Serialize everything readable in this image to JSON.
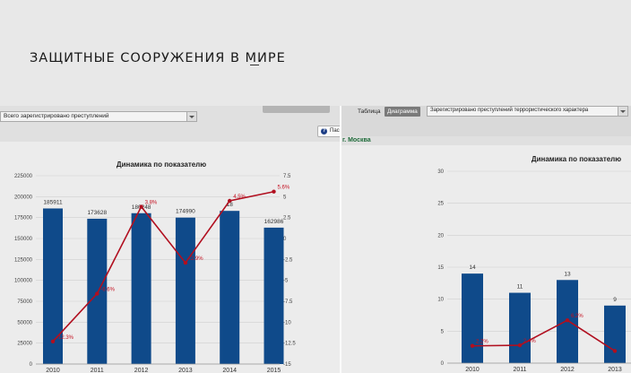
{
  "header": {
    "title": "ЗАЩИТНЫЕ СООРУЖЕНИЯ В МИРЕ"
  },
  "left_panel": {
    "select_value": "Всего зарегистрировано преступлений",
    "button_label": "Пас",
    "chart_title": "Динамика по показателю"
  },
  "right_panel": {
    "tab_table": "Таблица",
    "tab_chart": "Диаграмма",
    "select_value": "Зарегистрировано преступлений террористического характера",
    "region": "г. Москва",
    "chart_title": "Динамика по показателю"
  },
  "colors": {
    "bar": "#0f4a8a",
    "line": "#b10f1f",
    "label_red": "#c40f1f"
  },
  "chart_data": [
    {
      "type": "bar",
      "title": "Динамика по показателю",
      "categories": [
        "2010",
        "2011",
        "2012",
        "2013",
        "2014",
        "2015"
      ],
      "values": [
        185911,
        173628,
        180248,
        174990,
        183000,
        162986
      ],
      "value_labels": [
        "185911",
        "173628",
        "180248",
        "174990",
        "18",
        "162986"
      ],
      "ylim": [
        0,
        225000
      ],
      "yticks": [
        "0",
        "25000",
        "50000",
        "75000",
        "100000",
        "125000",
        "150000",
        "175000",
        "200000",
        "225000"
      ],
      "y2lim": [
        -15,
        7.5
      ],
      "y2ticks": [
        "-15",
        "-12.5",
        "-10",
        "-7.5",
        "-5",
        "-2.5",
        "0",
        "2.5",
        "5",
        "7.5"
      ],
      "line_values": [
        -12.3,
        -6.6,
        3.8,
        -2.9,
        4.5,
        5.6
      ],
      "line_labels": [
        "-12.3%",
        "-6.6%",
        "3.8%",
        "-2.9%",
        "4.5%",
        "5.6%"
      ],
      "grid": true
    },
    {
      "type": "bar",
      "title": "Динамика по показателю",
      "categories": [
        "2010",
        "2011",
        "2012",
        "2013"
      ],
      "values": [
        14,
        11,
        13,
        9
      ],
      "value_labels": [
        "14",
        "11",
        "13",
        "9"
      ],
      "ylim": [
        0,
        30
      ],
      "yticks": [
        "0",
        "5",
        "10",
        "15",
        "20",
        "25",
        "30"
      ],
      "line_values": [
        2.7,
        2.8,
        6.7,
        1.9
      ],
      "line_labels": [
        "2.2%",
        "2.4%",
        "6.2%",
        ""
      ],
      "grid": true
    }
  ]
}
